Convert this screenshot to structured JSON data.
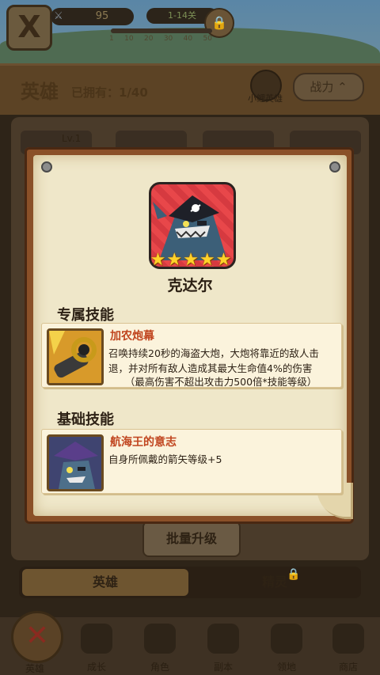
{
  "top": {
    "close_symbol": "X",
    "attack_value": "95",
    "stage": "1-14关",
    "progress_ticks": [
      "1",
      "10",
      "20",
      "30",
      "40",
      "50"
    ]
  },
  "header": {
    "title": "英雄",
    "owned": "已拥有：1/40",
    "badge_label": "小鲤英雄",
    "power_label": "战力",
    "power_chevron": "^"
  },
  "list": {
    "first_level": "Lv.1"
  },
  "batch_button": "批量升级",
  "toggle": {
    "hero": "英雄",
    "elite": "精灵"
  },
  "nav": {
    "items": [
      {
        "label": "英雄",
        "icon": "close-x-icon"
      },
      {
        "label": "成长",
        "icon": "snowman-icon"
      },
      {
        "label": "角色",
        "icon": "helmet-icon"
      },
      {
        "label": "副本",
        "icon": "crossed-swords-icon"
      },
      {
        "label": "领地",
        "icon": "castle-icon"
      },
      {
        "label": "商店",
        "icon": "chest-icon"
      }
    ]
  },
  "modal": {
    "hero_name": "克达尔",
    "stars": 5,
    "exclusive_title": "专属技能",
    "basic_title": "基础技能",
    "exclusive_skill": {
      "name": "加农炮幕",
      "desc": "召唤持续20秒的海盗大炮，大炮将靠近的敌人击退，并对所有敌人造成其最大生命值4%的伤害",
      "note": "（最高伤害不超出攻击力500倍*技能等级）"
    },
    "basic_skill": {
      "name": "航海王的意志",
      "desc": "自身所佩戴的箭矢等级+5"
    }
  },
  "colors": {
    "skill_name": "#c0441e",
    "star": "#ffd22a",
    "portrait_bg": "#e8474a",
    "frame": "#8a5028",
    "parchment": "#efe7c9"
  }
}
